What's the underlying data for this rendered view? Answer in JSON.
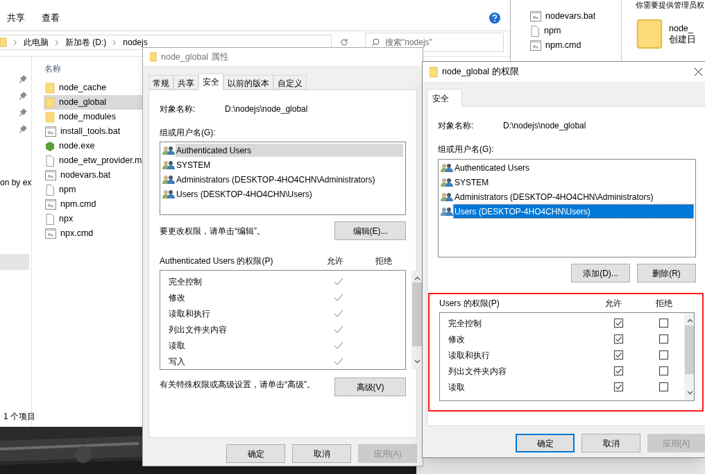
{
  "explorer": {
    "ribbon_tabs": [
      "共享",
      "查看"
    ],
    "breadcrumb": [
      "此电脑",
      "新加卷 (D:)",
      "nodejs"
    ],
    "search": {
      "placeholder": "搜索\"nodejs\""
    },
    "nav_text": "on by ex",
    "column_header": "名称",
    "files": [
      {
        "name": "node_cache",
        "kind": "folder",
        "selected": false
      },
      {
        "name": "node_global",
        "kind": "folder",
        "selected": true
      },
      {
        "name": "node_modules",
        "kind": "folder",
        "selected": false
      },
      {
        "name": "install_tools.bat",
        "kind": "script",
        "selected": false
      },
      {
        "name": "node.exe",
        "kind": "app",
        "selected": false
      },
      {
        "name": "node_etw_provider.m",
        "kind": "file",
        "selected": false
      },
      {
        "name": "nodevars.bat",
        "kind": "script",
        "selected": false
      },
      {
        "name": "npm",
        "kind": "file",
        "selected": false
      },
      {
        "name": "npm.cmd",
        "kind": "script",
        "selected": false
      },
      {
        "name": "npx",
        "kind": "file",
        "selected": false
      },
      {
        "name": "npx.cmd",
        "kind": "script",
        "selected": false
      }
    ],
    "status": "1 个项目"
  },
  "second_explorer": {
    "files": [
      {
        "name": "nodevars.bat",
        "kind": "script"
      },
      {
        "name": "npm",
        "kind": "file"
      },
      {
        "name": "npm.cmd",
        "kind": "script"
      }
    ],
    "details_notice": "你需要提供管理员权",
    "details_name": "node_",
    "details_created": "创建日"
  },
  "properties_dialog": {
    "title": "node_global 属性",
    "tabs": [
      {
        "label": "常规",
        "selected": false
      },
      {
        "label": "共享",
        "selected": false
      },
      {
        "label": "安全",
        "selected": true
      },
      {
        "label": "以前的版本",
        "selected": false
      },
      {
        "label": "自定义",
        "selected": false
      }
    ],
    "object_label": "对象名称:",
    "object_value": "D:\\nodejs\\node_global",
    "groups_label": "组或用户名(G):",
    "groups": [
      {
        "name": "Authenticated Users",
        "selected": true
      },
      {
        "name": "SYSTEM",
        "selected": false
      },
      {
        "name": "Administrators (DESKTOP-4HO4CHN\\Administrators)",
        "selected": false
      },
      {
        "name": "Users (DESKTOP-4HO4CHN\\Users)",
        "selected": false
      }
    ],
    "edit_hint": "要更改权限，请单击“编辑”。",
    "edit_button": "编辑(E)...",
    "permissions_label": "Authenticated Users 的权限(P)",
    "allow_header": "允许",
    "deny_header": "拒绝",
    "permissions": [
      {
        "name": "完全控制",
        "allow": true
      },
      {
        "name": "修改",
        "allow": true
      },
      {
        "name": "读取和执行",
        "allow": true
      },
      {
        "name": "列出文件夹内容",
        "allow": true
      },
      {
        "name": "读取",
        "allow": true
      },
      {
        "name": "写入",
        "allow": true
      }
    ],
    "advanced_hint": "有关特殊权限或高级设置，请单击“高级”。",
    "advanced_button": "高级(V)",
    "buttons": [
      {
        "label": "确定",
        "disabled": false
      },
      {
        "label": "取消",
        "disabled": false
      },
      {
        "label": "应用(A)",
        "disabled": true
      }
    ]
  },
  "permissions_dialog": {
    "title": "node_global 的权限",
    "tab": "安全",
    "object_label": "对象名称:",
    "object_value": "D:\\nodejs\\node_global",
    "groups_label": "组或用户名(G):",
    "groups": [
      {
        "name": "Authenticated Users",
        "selected": false
      },
      {
        "name": "SYSTEM",
        "selected": false
      },
      {
        "name": "Administrators (DESKTOP-4HO4CHN\\Administrators)",
        "selected": false
      },
      {
        "name": "Users (DESKTOP-4HO4CHN\\Users)",
        "selected": true
      }
    ],
    "add_button": "添加(D)...",
    "remove_button": "删除(R)",
    "highlighted": true,
    "permissions_label": "Users 的权限(P)",
    "allow_header": "允许",
    "deny_header": "拒绝",
    "permissions": [
      {
        "name": "完全控制",
        "allow": true,
        "deny": false
      },
      {
        "name": "修改",
        "allow": true,
        "deny": false
      },
      {
        "name": "读取和执行",
        "allow": true,
        "deny": false
      },
      {
        "name": "列出文件夹内容",
        "allow": true,
        "deny": false
      },
      {
        "name": "读取",
        "allow": true,
        "deny": false
      }
    ],
    "buttons": [
      {
        "label": "确定",
        "disabled": false,
        "focused": true
      },
      {
        "label": "取消",
        "disabled": false,
        "focused": false
      },
      {
        "label": "应用(A)",
        "disabled": true,
        "focused": false
      }
    ]
  }
}
